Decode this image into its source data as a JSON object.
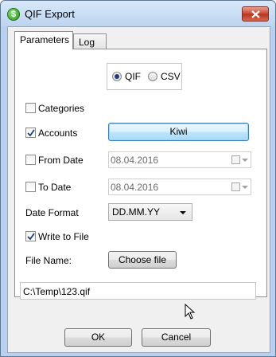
{
  "window": {
    "title": "QIF Export",
    "icon_glyph": "$"
  },
  "tabs": [
    {
      "label": "Parameters",
      "active": true
    },
    {
      "label": "Log",
      "active": false
    }
  ],
  "format": {
    "options": [
      "QIF",
      "CSV"
    ],
    "selected": "QIF"
  },
  "categories": {
    "label": "Categories",
    "checked": false
  },
  "accounts": {
    "label": "Accounts",
    "checked": true,
    "button_label": "Kiwi"
  },
  "from_date": {
    "label": "From Date",
    "checked": false,
    "value": "08.04.2016"
  },
  "to_date": {
    "label": "To Date",
    "checked": false,
    "value": "08.04.2016"
  },
  "date_format": {
    "label": "Date Format",
    "value": "DD.MM.YY"
  },
  "write_to_file": {
    "label": "Write to File",
    "checked": true
  },
  "file_name": {
    "label": "File Name:",
    "button_label": "Choose file",
    "path": "C:\\Temp\\123.qif"
  },
  "footer": {
    "ok_label": "OK",
    "cancel_label": "Cancel"
  },
  "colors": {
    "title_bar": "#bdd4ef",
    "close_button": "#c9452e",
    "highlight_button": "#bee6fd"
  }
}
